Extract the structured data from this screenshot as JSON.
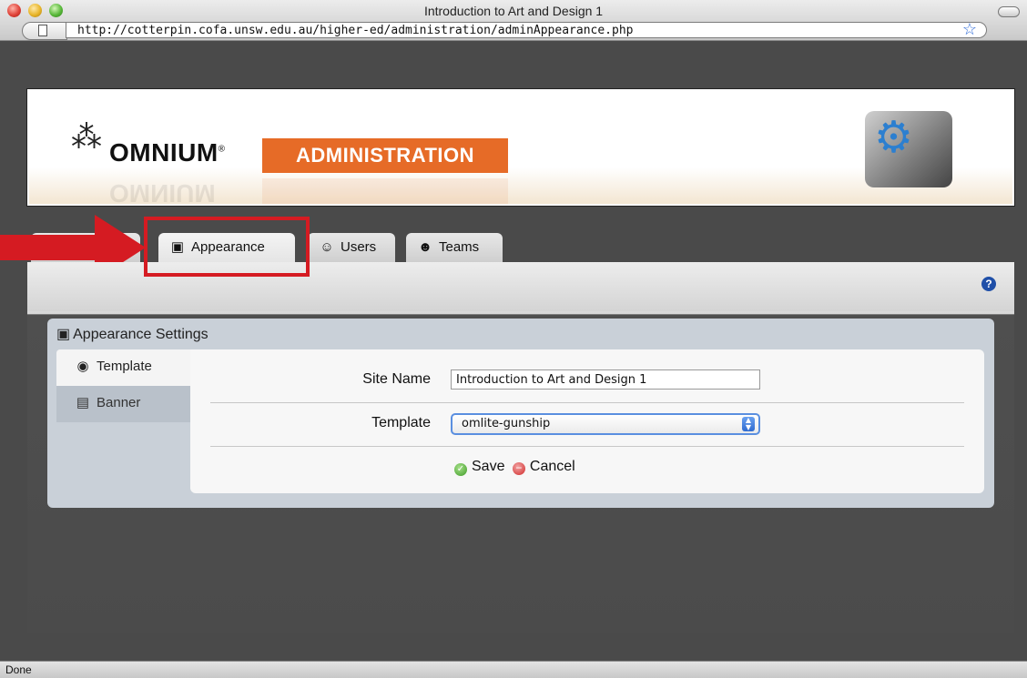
{
  "window": {
    "title": "Introduction to Art and Design 1",
    "url": "http://cotterpin.cofa.unsw.edu.au/higher-ed/administration/adminAppearance.php",
    "status": "Done"
  },
  "header": {
    "logo_text": "OMNIUM",
    "logo_reg": "®",
    "section": "ADMINISTRATION"
  },
  "tabs": [
    {
      "label": "",
      "icon": "hidden-tab-icon"
    },
    {
      "label": "Appearance",
      "icon": "appearance-icon",
      "active": true
    },
    {
      "label": "Users",
      "icon": "users-icon"
    },
    {
      "label": "Teams",
      "icon": "teams-icon"
    }
  ],
  "panel": {
    "title": "Appearance Settings",
    "side_nav": [
      {
        "label": "Template",
        "icon": "color-wheel-icon",
        "active": true
      },
      {
        "label": "Banner",
        "icon": "banner-icon"
      }
    ],
    "form": {
      "site_name_label": "Site Name",
      "site_name_value": "Introduction to Art and Design 1",
      "template_label": "Template",
      "template_value": "omlite-gunship",
      "save_label": "Save",
      "cancel_label": "Cancel"
    }
  },
  "colors": {
    "accent_orange": "#e66b27",
    "highlight_red": "#d51b22"
  }
}
